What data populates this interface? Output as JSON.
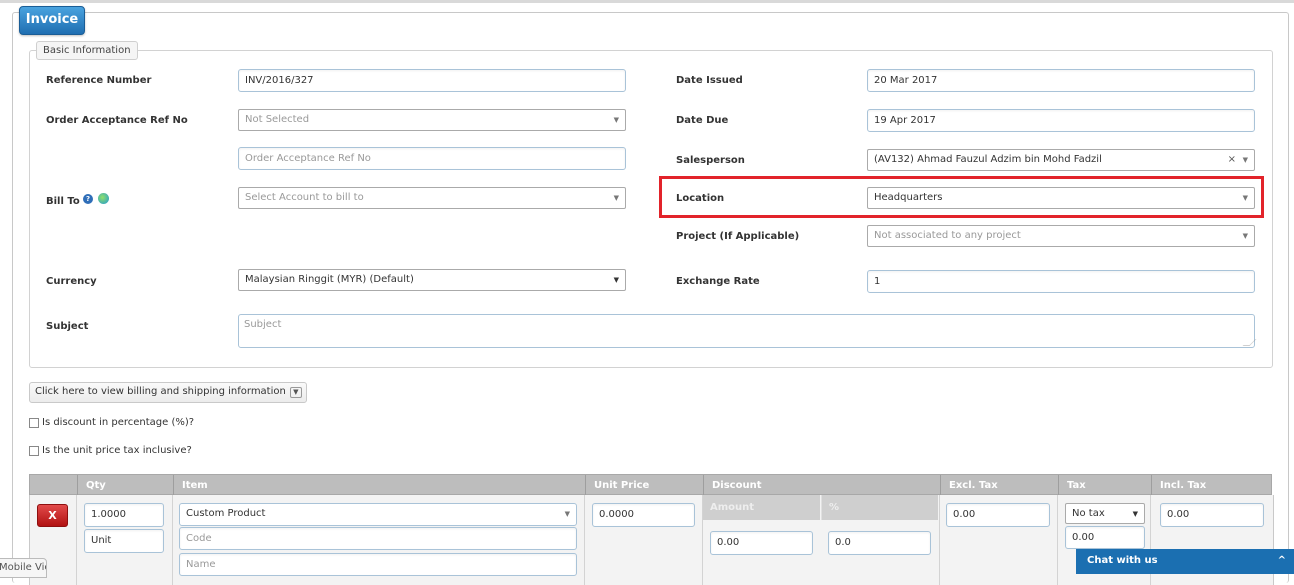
{
  "header": {
    "title": "Invoice"
  },
  "basic_info": {
    "legend": "Basic Information",
    "reference_number": {
      "label": "Reference Number",
      "value": "INV/2016/327"
    },
    "order_acceptance": {
      "label": "Order Acceptance Ref No",
      "select_placeholder": "Not Selected",
      "input_placeholder": "Order Acceptance Ref No"
    },
    "bill_to": {
      "label": "Bill To",
      "placeholder": "Select Account to bill to"
    },
    "currency": {
      "label": "Currency",
      "value": "Malaysian Ringgit (MYR) (Default)"
    },
    "subject": {
      "label": "Subject",
      "placeholder": "Subject"
    },
    "date_issued": {
      "label": "Date Issued",
      "value": "20 Mar 2017"
    },
    "date_due": {
      "label": "Date Due",
      "value": "19 Apr 2017"
    },
    "salesperson": {
      "label": "Salesperson",
      "value": "(AV132) Ahmad Fauzul Adzim bin Mohd Fadzil",
      "clear": "×"
    },
    "location": {
      "label": "Location",
      "value": "Headquarters"
    },
    "project": {
      "label": "Project (If Applicable)",
      "placeholder": "Not associated to any project"
    },
    "exchange_rate": {
      "label": "Exchange Rate",
      "value": "1"
    }
  },
  "billing_toggle": {
    "label": "Click here to view billing and shipping information"
  },
  "options": {
    "discount_percentage": "Is discount in percentage (%)?",
    "tax_inclusive": "Is the unit price tax inclusive?"
  },
  "grid": {
    "columns": [
      "Qty",
      "Item",
      "Unit Price",
      "Discount",
      "Excl. Tax",
      "Tax",
      "Incl. Tax"
    ],
    "discount_sub": [
      "Amount",
      "%"
    ],
    "row": {
      "remove": "X",
      "qty": "1.0000",
      "unit": "Unit",
      "item": "Custom Product",
      "code_placeholder": "Code",
      "name_placeholder": "Name",
      "unit_price": "0.0000",
      "discount_amount": "0.00",
      "discount_percent": "0.0",
      "excl_tax": "0.00",
      "tax_select": "No tax",
      "tax_amount": "0.00",
      "incl_tax": "0.00"
    }
  },
  "footer": {
    "mobile_view": "Mobile View",
    "chat": "Chat with us",
    "chat_caret": "^"
  },
  "colors": {
    "accent": "#1f6eb1",
    "highlight": "#e2232a",
    "chat": "#1b6fb1"
  }
}
